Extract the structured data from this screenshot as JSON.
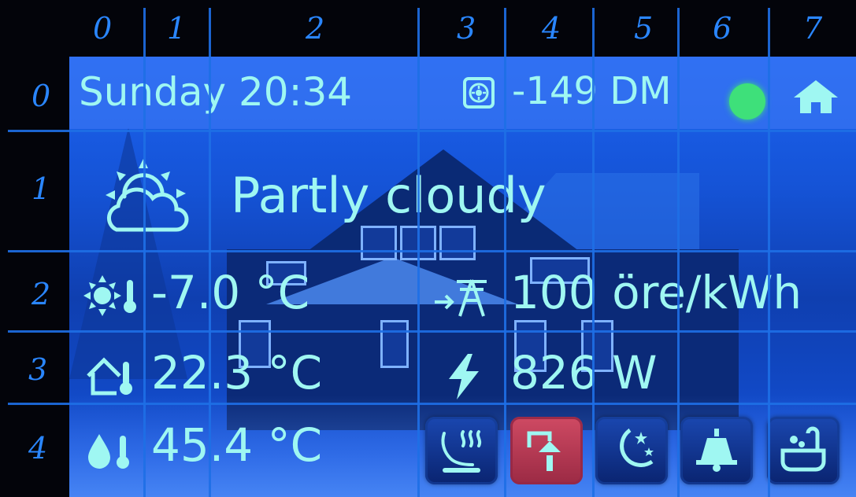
{
  "header": {
    "day_time": "Sunday 20:34",
    "credit_icon": "coin-icon",
    "credit": "-149 DM",
    "status_color": "#3ee07a",
    "home_icon": "home-icon"
  },
  "weather": {
    "icon": "partly-cloudy-icon",
    "condition": "Partly cloudy"
  },
  "readings": {
    "outdoor_temp": "-7.0 °C",
    "electricity_price": "100 öre/kWh",
    "indoor_temp": "22.3 °C",
    "power": "826 W",
    "water_temp": "45.4 °C"
  },
  "buttons": [
    {
      "icon": "floor-heating-icon",
      "active": false
    },
    {
      "icon": "shower-icon",
      "active": true,
      "active_color": "#cf4a63"
    },
    {
      "icon": "night-mode-icon",
      "active": false
    },
    {
      "icon": "bell-icon",
      "active": false
    },
    {
      "icon": "bathtub-icon",
      "active": false
    }
  ],
  "grid_overlay": {
    "column_labels": [
      "0",
      "1",
      "2",
      "3",
      "4",
      "5",
      "6",
      "7"
    ],
    "row_labels": [
      "0",
      "1",
      "2",
      "3",
      "4"
    ]
  },
  "colors": {
    "text": "#9ff7f2",
    "screen_blue": "#1553d6"
  }
}
